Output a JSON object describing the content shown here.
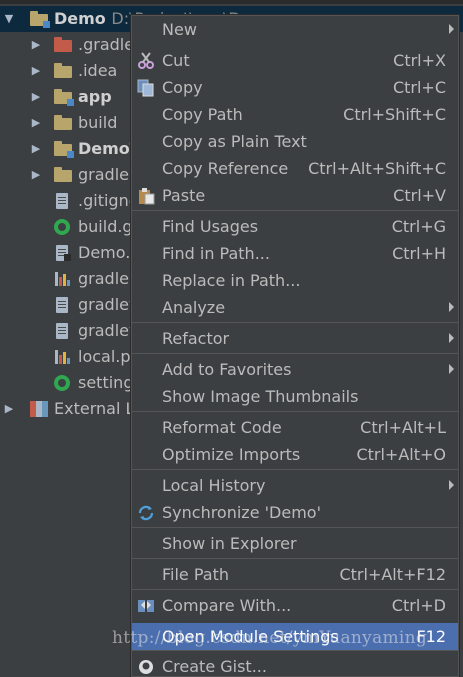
{
  "tree": {
    "root": {
      "label": "Demo",
      "path": "D:\\Project\\xxx\\D"
    },
    "items": [
      {
        "label": ".gradle",
        "kind": "folder-excluded",
        "expanded": false
      },
      {
        "label": ".idea",
        "kind": "folder",
        "expanded": false
      },
      {
        "label": "app",
        "kind": "module",
        "expanded": false,
        "bold": true
      },
      {
        "label": "build",
        "kind": "folder",
        "expanded": false
      },
      {
        "label": "DemoT",
        "kind": "module",
        "expanded": false,
        "bold": true
      },
      {
        "label": "gradle",
        "kind": "folder",
        "expanded": false
      },
      {
        "label": ".gitignc",
        "kind": "file"
      },
      {
        "label": "build.g",
        "kind": "gradle"
      },
      {
        "label": "Demo.i",
        "kind": "iml"
      },
      {
        "label": "gradle.",
        "kind": "properties"
      },
      {
        "label": "gradlev",
        "kind": "file"
      },
      {
        "label": "gradlev",
        "kind": "file"
      },
      {
        "label": "local.pr",
        "kind": "properties"
      },
      {
        "label": "setting",
        "kind": "gradle"
      }
    ],
    "external": {
      "label": "External Li"
    }
  },
  "menu": {
    "items": [
      {
        "label": "New",
        "shortcut": "",
        "submenu": true,
        "icon": ""
      },
      {
        "label": "Cut",
        "shortcut": "Ctrl+X",
        "submenu": false,
        "icon": "scissors-icon"
      },
      {
        "label": "Copy",
        "shortcut": "Ctrl+C",
        "submenu": false,
        "icon": "copy-icon"
      },
      {
        "label": "Copy Path",
        "shortcut": "Ctrl+Shift+C",
        "submenu": false,
        "icon": ""
      },
      {
        "label": "Copy as Plain Text",
        "shortcut": "",
        "submenu": false,
        "icon": ""
      },
      {
        "label": "Copy Reference",
        "shortcut": "Ctrl+Alt+Shift+C",
        "submenu": false,
        "icon": ""
      },
      {
        "label": "Paste",
        "shortcut": "Ctrl+V",
        "submenu": false,
        "icon": "paste-icon"
      },
      {
        "label": "Find Usages",
        "shortcut": "Ctrl+G",
        "submenu": false,
        "icon": ""
      },
      {
        "label": "Find in Path...",
        "shortcut": "Ctrl+H",
        "submenu": false,
        "icon": ""
      },
      {
        "label": "Replace in Path...",
        "shortcut": "",
        "submenu": false,
        "icon": ""
      },
      {
        "label": "Analyze",
        "shortcut": "",
        "submenu": true,
        "icon": ""
      },
      {
        "label": "Refactor",
        "shortcut": "",
        "submenu": true,
        "icon": ""
      },
      {
        "label": "Add to Favorites",
        "shortcut": "",
        "submenu": true,
        "icon": ""
      },
      {
        "label": "Show Image Thumbnails",
        "shortcut": "",
        "submenu": false,
        "icon": ""
      },
      {
        "label": "Reformat Code",
        "shortcut": "Ctrl+Alt+L",
        "submenu": false,
        "icon": ""
      },
      {
        "label": "Optimize Imports",
        "shortcut": "Ctrl+Alt+O",
        "submenu": false,
        "icon": ""
      },
      {
        "label": "Local History",
        "shortcut": "",
        "submenu": true,
        "icon": ""
      },
      {
        "label": "Synchronize 'Demo'",
        "shortcut": "",
        "submenu": false,
        "icon": "sync-icon"
      },
      {
        "label": "Show in Explorer",
        "shortcut": "",
        "submenu": false,
        "icon": ""
      },
      {
        "label": "File Path",
        "shortcut": "Ctrl+Alt+F12",
        "submenu": false,
        "icon": ""
      },
      {
        "label": "Compare With...",
        "shortcut": "Ctrl+D",
        "submenu": false,
        "icon": "compare-icon"
      },
      {
        "label": "Open Module Settings",
        "shortcut": "F12",
        "submenu": false,
        "icon": "",
        "highlighted": true
      },
      {
        "label": "Create Gist...",
        "shortcut": "",
        "submenu": false,
        "icon": "github-icon"
      }
    ]
  },
  "watermark": "http://blog.csdn.net/ymYuanyaming",
  "colors": {
    "background": "#3c3f41",
    "highlight": "#4b6eaf",
    "selection": "#0d293e",
    "text": "#bbbbbb"
  }
}
